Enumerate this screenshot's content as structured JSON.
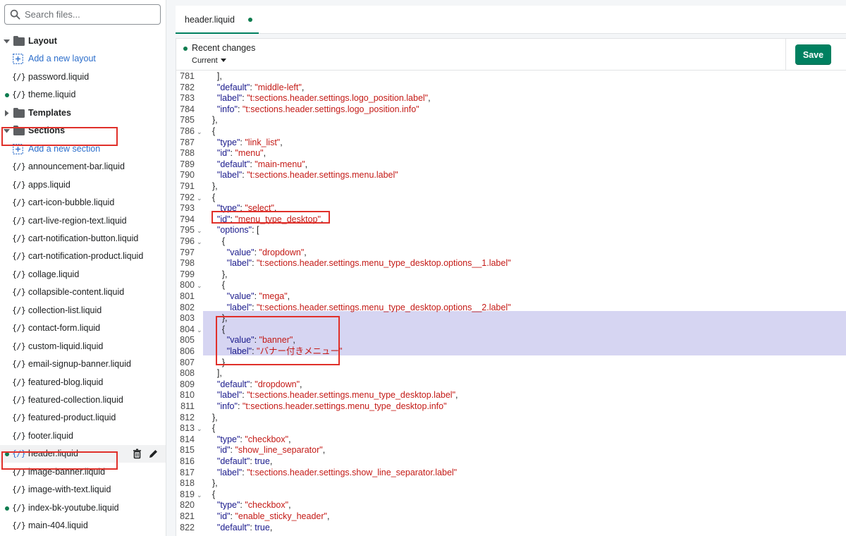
{
  "search": {
    "placeholder": "Search files..."
  },
  "sidebar": {
    "rows": [
      {
        "kind": "folder",
        "label": "Layout",
        "expanded": true
      },
      {
        "kind": "add",
        "label": "Add a new layout"
      },
      {
        "kind": "file",
        "label": "password.liquid"
      },
      {
        "kind": "file",
        "label": "theme.liquid",
        "modified": true
      },
      {
        "kind": "folder",
        "label": "Templates",
        "expanded": false
      },
      {
        "kind": "folder",
        "label": "Sections",
        "expanded": true,
        "highlighted": true
      },
      {
        "kind": "add",
        "label": "Add a new section"
      },
      {
        "kind": "file",
        "label": "announcement-bar.liquid"
      },
      {
        "kind": "file",
        "label": "apps.liquid"
      },
      {
        "kind": "file",
        "label": "cart-icon-bubble.liquid"
      },
      {
        "kind": "file",
        "label": "cart-live-region-text.liquid"
      },
      {
        "kind": "file",
        "label": "cart-notification-button.liquid"
      },
      {
        "kind": "file",
        "label": "cart-notification-product.liquid"
      },
      {
        "kind": "file",
        "label": "collage.liquid"
      },
      {
        "kind": "file",
        "label": "collapsible-content.liquid"
      },
      {
        "kind": "file",
        "label": "collection-list.liquid"
      },
      {
        "kind": "file",
        "label": "contact-form.liquid"
      },
      {
        "kind": "file",
        "label": "custom-liquid.liquid"
      },
      {
        "kind": "file",
        "label": "email-signup-banner.liquid"
      },
      {
        "kind": "file",
        "label": "featured-blog.liquid"
      },
      {
        "kind": "file",
        "label": "featured-collection.liquid"
      },
      {
        "kind": "file",
        "label": "featured-product.liquid"
      },
      {
        "kind": "file",
        "label": "footer.liquid"
      },
      {
        "kind": "file",
        "label": "header.liquid",
        "modified": true,
        "selected": true,
        "highlighted": true
      },
      {
        "kind": "file",
        "label": "image-banner.liquid"
      },
      {
        "kind": "file",
        "label": "image-with-text.liquid"
      },
      {
        "kind": "file",
        "label": "index-bk-youtube.liquid",
        "modified": true
      },
      {
        "kind": "file",
        "label": "main-404.liquid"
      }
    ],
    "file_icon_text": "{/}"
  },
  "tab": {
    "label": "header.liquid",
    "unsaved": true
  },
  "editor_header": {
    "recent_changes_label": "Recent changes",
    "current_label": "Current",
    "save_label": "Save"
  },
  "colors": {
    "accent": "#008060",
    "modified_dot": "#0e7c4f",
    "link": "#2c6ecb",
    "annotation": "#e0302a",
    "code_key": "#1a1a8c",
    "code_string": "#c41a16",
    "highlight": "#d6d5f2"
  },
  "code": {
    "lines": [
      {
        "n": "781",
        "fold": false,
        "tokens": [
          [
            "p",
            "    ],"
          ]
        ]
      },
      {
        "n": "782",
        "fold": false,
        "tokens": [
          [
            "p",
            "    "
          ],
          [
            "key",
            "\"default\""
          ],
          [
            "p",
            ": "
          ],
          [
            "str",
            "\"middle-left\""
          ],
          [
            "p",
            ","
          ]
        ]
      },
      {
        "n": "783",
        "fold": false,
        "tokens": [
          [
            "p",
            "    "
          ],
          [
            "key",
            "\"label\""
          ],
          [
            "p",
            ": "
          ],
          [
            "str",
            "\"t:sections.header.settings.logo_position.label\""
          ],
          [
            "p",
            ","
          ]
        ]
      },
      {
        "n": "784",
        "fold": false,
        "tokens": [
          [
            "p",
            "    "
          ],
          [
            "key",
            "\"info\""
          ],
          [
            "p",
            ": "
          ],
          [
            "str",
            "\"t:sections.header.settings.logo_position.info\""
          ]
        ]
      },
      {
        "n": "785",
        "fold": false,
        "tokens": [
          [
            "p",
            "  },"
          ]
        ]
      },
      {
        "n": "786",
        "fold": true,
        "tokens": [
          [
            "p",
            "  {"
          ]
        ]
      },
      {
        "n": "787",
        "fold": false,
        "tokens": [
          [
            "p",
            "    "
          ],
          [
            "key",
            "\"type\""
          ],
          [
            "p",
            ": "
          ],
          [
            "str",
            "\"link_list\""
          ],
          [
            "p",
            ","
          ]
        ]
      },
      {
        "n": "788",
        "fold": false,
        "tokens": [
          [
            "p",
            "    "
          ],
          [
            "key",
            "\"id\""
          ],
          [
            "p",
            ": "
          ],
          [
            "str",
            "\"menu\""
          ],
          [
            "p",
            ","
          ]
        ]
      },
      {
        "n": "789",
        "fold": false,
        "tokens": [
          [
            "p",
            "    "
          ],
          [
            "key",
            "\"default\""
          ],
          [
            "p",
            ": "
          ],
          [
            "str",
            "\"main-menu\""
          ],
          [
            "p",
            ","
          ]
        ]
      },
      {
        "n": "790",
        "fold": false,
        "tokens": [
          [
            "p",
            "    "
          ],
          [
            "key",
            "\"label\""
          ],
          [
            "p",
            ": "
          ],
          [
            "str",
            "\"t:sections.header.settings.menu.label\""
          ]
        ]
      },
      {
        "n": "791",
        "fold": false,
        "tokens": [
          [
            "p",
            "  },"
          ]
        ]
      },
      {
        "n": "792",
        "fold": true,
        "tokens": [
          [
            "p",
            "  {"
          ]
        ]
      },
      {
        "n": "793",
        "fold": false,
        "tokens": [
          [
            "p",
            "    "
          ],
          [
            "key",
            "\"type\""
          ],
          [
            "p",
            ": "
          ],
          [
            "str",
            "\"select\""
          ],
          [
            "p",
            ","
          ]
        ]
      },
      {
        "n": "794",
        "fold": false,
        "tokens": [
          [
            "p",
            "    "
          ],
          [
            "key",
            "\"id\""
          ],
          [
            "p",
            ": "
          ],
          [
            "str",
            "\"menu_type_desktop\""
          ],
          [
            "p",
            ","
          ]
        ]
      },
      {
        "n": "795",
        "fold": true,
        "tokens": [
          [
            "p",
            "    "
          ],
          [
            "key",
            "\"options\""
          ],
          [
            "p",
            ": ["
          ]
        ]
      },
      {
        "n": "796",
        "fold": true,
        "tokens": [
          [
            "p",
            "      {"
          ]
        ]
      },
      {
        "n": "797",
        "fold": false,
        "tokens": [
          [
            "p",
            "        "
          ],
          [
            "key",
            "\"value\""
          ],
          [
            "p",
            ": "
          ],
          [
            "str",
            "\"dropdown\""
          ],
          [
            "p",
            ","
          ]
        ]
      },
      {
        "n": "798",
        "fold": false,
        "tokens": [
          [
            "p",
            "        "
          ],
          [
            "key",
            "\"label\""
          ],
          [
            "p",
            ": "
          ],
          [
            "str",
            "\"t:sections.header.settings.menu_type_desktop.options__1.label\""
          ]
        ]
      },
      {
        "n": "799",
        "fold": false,
        "tokens": [
          [
            "p",
            "      },"
          ]
        ]
      },
      {
        "n": "800",
        "fold": true,
        "tokens": [
          [
            "p",
            "      {"
          ]
        ]
      },
      {
        "n": "801",
        "fold": false,
        "tokens": [
          [
            "p",
            "        "
          ],
          [
            "key",
            "\"value\""
          ],
          [
            "p",
            ": "
          ],
          [
            "str",
            "\"mega\""
          ],
          [
            "p",
            ","
          ]
        ]
      },
      {
        "n": "802",
        "fold": false,
        "tokens": [
          [
            "p",
            "        "
          ],
          [
            "key",
            "\"label\""
          ],
          [
            "p",
            ": "
          ],
          [
            "str",
            "\"t:sections.header.settings.menu_type_desktop.options__2.label\""
          ]
        ]
      },
      {
        "n": "803",
        "fold": false,
        "tokens": [
          [
            "p",
            "      },"
          ]
        ]
      },
      {
        "n": "804",
        "fold": true,
        "tokens": [
          [
            "p",
            "      {"
          ]
        ]
      },
      {
        "n": "805",
        "fold": false,
        "tokens": [
          [
            "p",
            "        "
          ],
          [
            "key",
            "\"value\""
          ],
          [
            "p",
            ": "
          ],
          [
            "str",
            "\"banner\""
          ],
          [
            "p",
            ","
          ]
        ]
      },
      {
        "n": "806",
        "fold": false,
        "tokens": [
          [
            "p",
            "        "
          ],
          [
            "key",
            "\"label\""
          ],
          [
            "p",
            ": "
          ],
          [
            "str",
            "\"バナー付きメニュー\""
          ]
        ]
      },
      {
        "n": "807",
        "fold": false,
        "tokens": [
          [
            "p",
            "      }"
          ]
        ]
      },
      {
        "n": "808",
        "fold": false,
        "tokens": [
          [
            "p",
            "    ],"
          ]
        ]
      },
      {
        "n": "809",
        "fold": false,
        "tokens": [
          [
            "p",
            "    "
          ],
          [
            "key",
            "\"default\""
          ],
          [
            "p",
            ": "
          ],
          [
            "str",
            "\"dropdown\""
          ],
          [
            "p",
            ","
          ]
        ]
      },
      {
        "n": "810",
        "fold": false,
        "tokens": [
          [
            "p",
            "    "
          ],
          [
            "key",
            "\"label\""
          ],
          [
            "p",
            ": "
          ],
          [
            "str",
            "\"t:sections.header.settings.menu_type_desktop.label\""
          ],
          [
            "p",
            ","
          ]
        ]
      },
      {
        "n": "811",
        "fold": false,
        "tokens": [
          [
            "p",
            "    "
          ],
          [
            "key",
            "\"info\""
          ],
          [
            "p",
            ": "
          ],
          [
            "str",
            "\"t:sections.header.settings.menu_type_desktop.info\""
          ]
        ]
      },
      {
        "n": "812",
        "fold": false,
        "tokens": [
          [
            "p",
            "  },"
          ]
        ]
      },
      {
        "n": "813",
        "fold": true,
        "tokens": [
          [
            "p",
            "  {"
          ]
        ]
      },
      {
        "n": "814",
        "fold": false,
        "tokens": [
          [
            "p",
            "    "
          ],
          [
            "key",
            "\"type\""
          ],
          [
            "p",
            ": "
          ],
          [
            "str",
            "\"checkbox\""
          ],
          [
            "p",
            ","
          ]
        ]
      },
      {
        "n": "815",
        "fold": false,
        "tokens": [
          [
            "p",
            "    "
          ],
          [
            "key",
            "\"id\""
          ],
          [
            "p",
            ": "
          ],
          [
            "str",
            "\"show_line_separator\""
          ],
          [
            "p",
            ","
          ]
        ]
      },
      {
        "n": "816",
        "fold": false,
        "tokens": [
          [
            "p",
            "    "
          ],
          [
            "key",
            "\"default\""
          ],
          [
            "p",
            ": "
          ],
          [
            "lit",
            "true"
          ],
          [
            "p",
            ","
          ]
        ]
      },
      {
        "n": "817",
        "fold": false,
        "tokens": [
          [
            "p",
            "    "
          ],
          [
            "key",
            "\"label\""
          ],
          [
            "p",
            ": "
          ],
          [
            "str",
            "\"t:sections.header.settings.show_line_separator.label\""
          ]
        ]
      },
      {
        "n": "818",
        "fold": false,
        "tokens": [
          [
            "p",
            "  },"
          ]
        ]
      },
      {
        "n": "819",
        "fold": true,
        "tokens": [
          [
            "p",
            "  {"
          ]
        ]
      },
      {
        "n": "820",
        "fold": false,
        "tokens": [
          [
            "p",
            "    "
          ],
          [
            "key",
            "\"type\""
          ],
          [
            "p",
            ": "
          ],
          [
            "str",
            "\"checkbox\""
          ],
          [
            "p",
            ","
          ]
        ]
      },
      {
        "n": "821",
        "fold": false,
        "tokens": [
          [
            "p",
            "    "
          ],
          [
            "key",
            "\"id\""
          ],
          [
            "p",
            ": "
          ],
          [
            "str",
            "\"enable_sticky_header\""
          ],
          [
            "p",
            ","
          ]
        ]
      },
      {
        "n": "822",
        "fold": false,
        "tokens": [
          [
            "p",
            "    "
          ],
          [
            "key",
            "\"default\""
          ],
          [
            "p",
            ": "
          ],
          [
            "lit",
            "true"
          ],
          [
            "p",
            ","
          ]
        ]
      }
    ]
  }
}
